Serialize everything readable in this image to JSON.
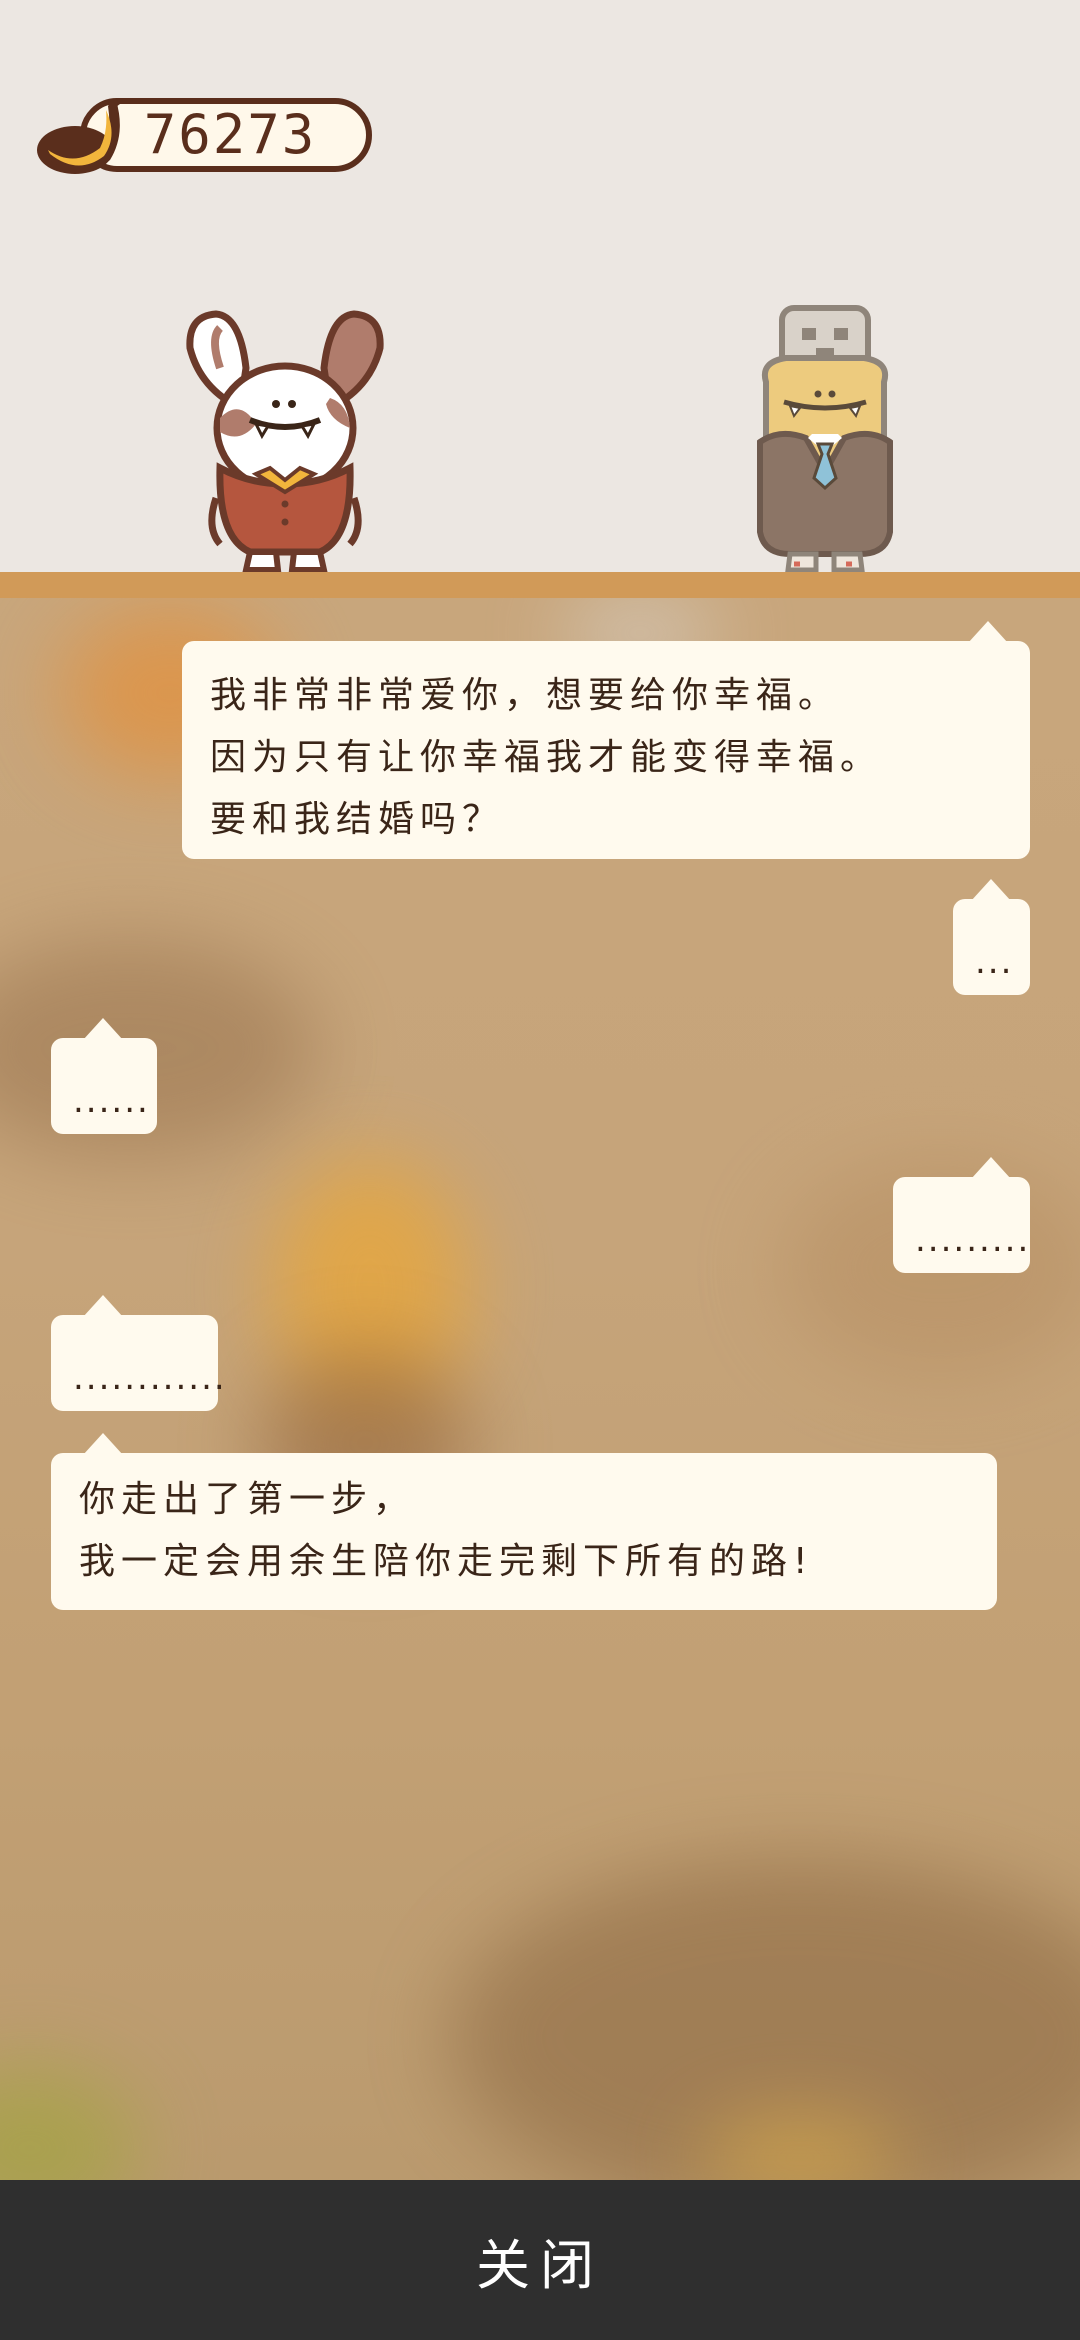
{
  "hud": {
    "banana_count": "76273",
    "banana_icon": "banana-icon"
  },
  "characters": {
    "left": "bunny-character",
    "right": "robot-businessman-character"
  },
  "dialogue": [
    {
      "side": "right",
      "text": "我非常非常爱你，想要给你幸福。\n因为只有让你幸福我才能变得幸福。\n要和我结婚吗？"
    },
    {
      "side": "right",
      "text": "..."
    },
    {
      "side": "left",
      "text": "......"
    },
    {
      "side": "right",
      "text": "........."
    },
    {
      "side": "left",
      "text": "............"
    },
    {
      "side": "left",
      "text": "你走出了第一步，\n我一定会用余生陪你走完剩下所有的路!"
    }
  ],
  "footer": {
    "close_label": "关闭"
  },
  "colors": {
    "bubble": "#FFFAEE",
    "text": "#3A2518",
    "shelf": "#D19A58",
    "footer": "#2F2F2F"
  }
}
